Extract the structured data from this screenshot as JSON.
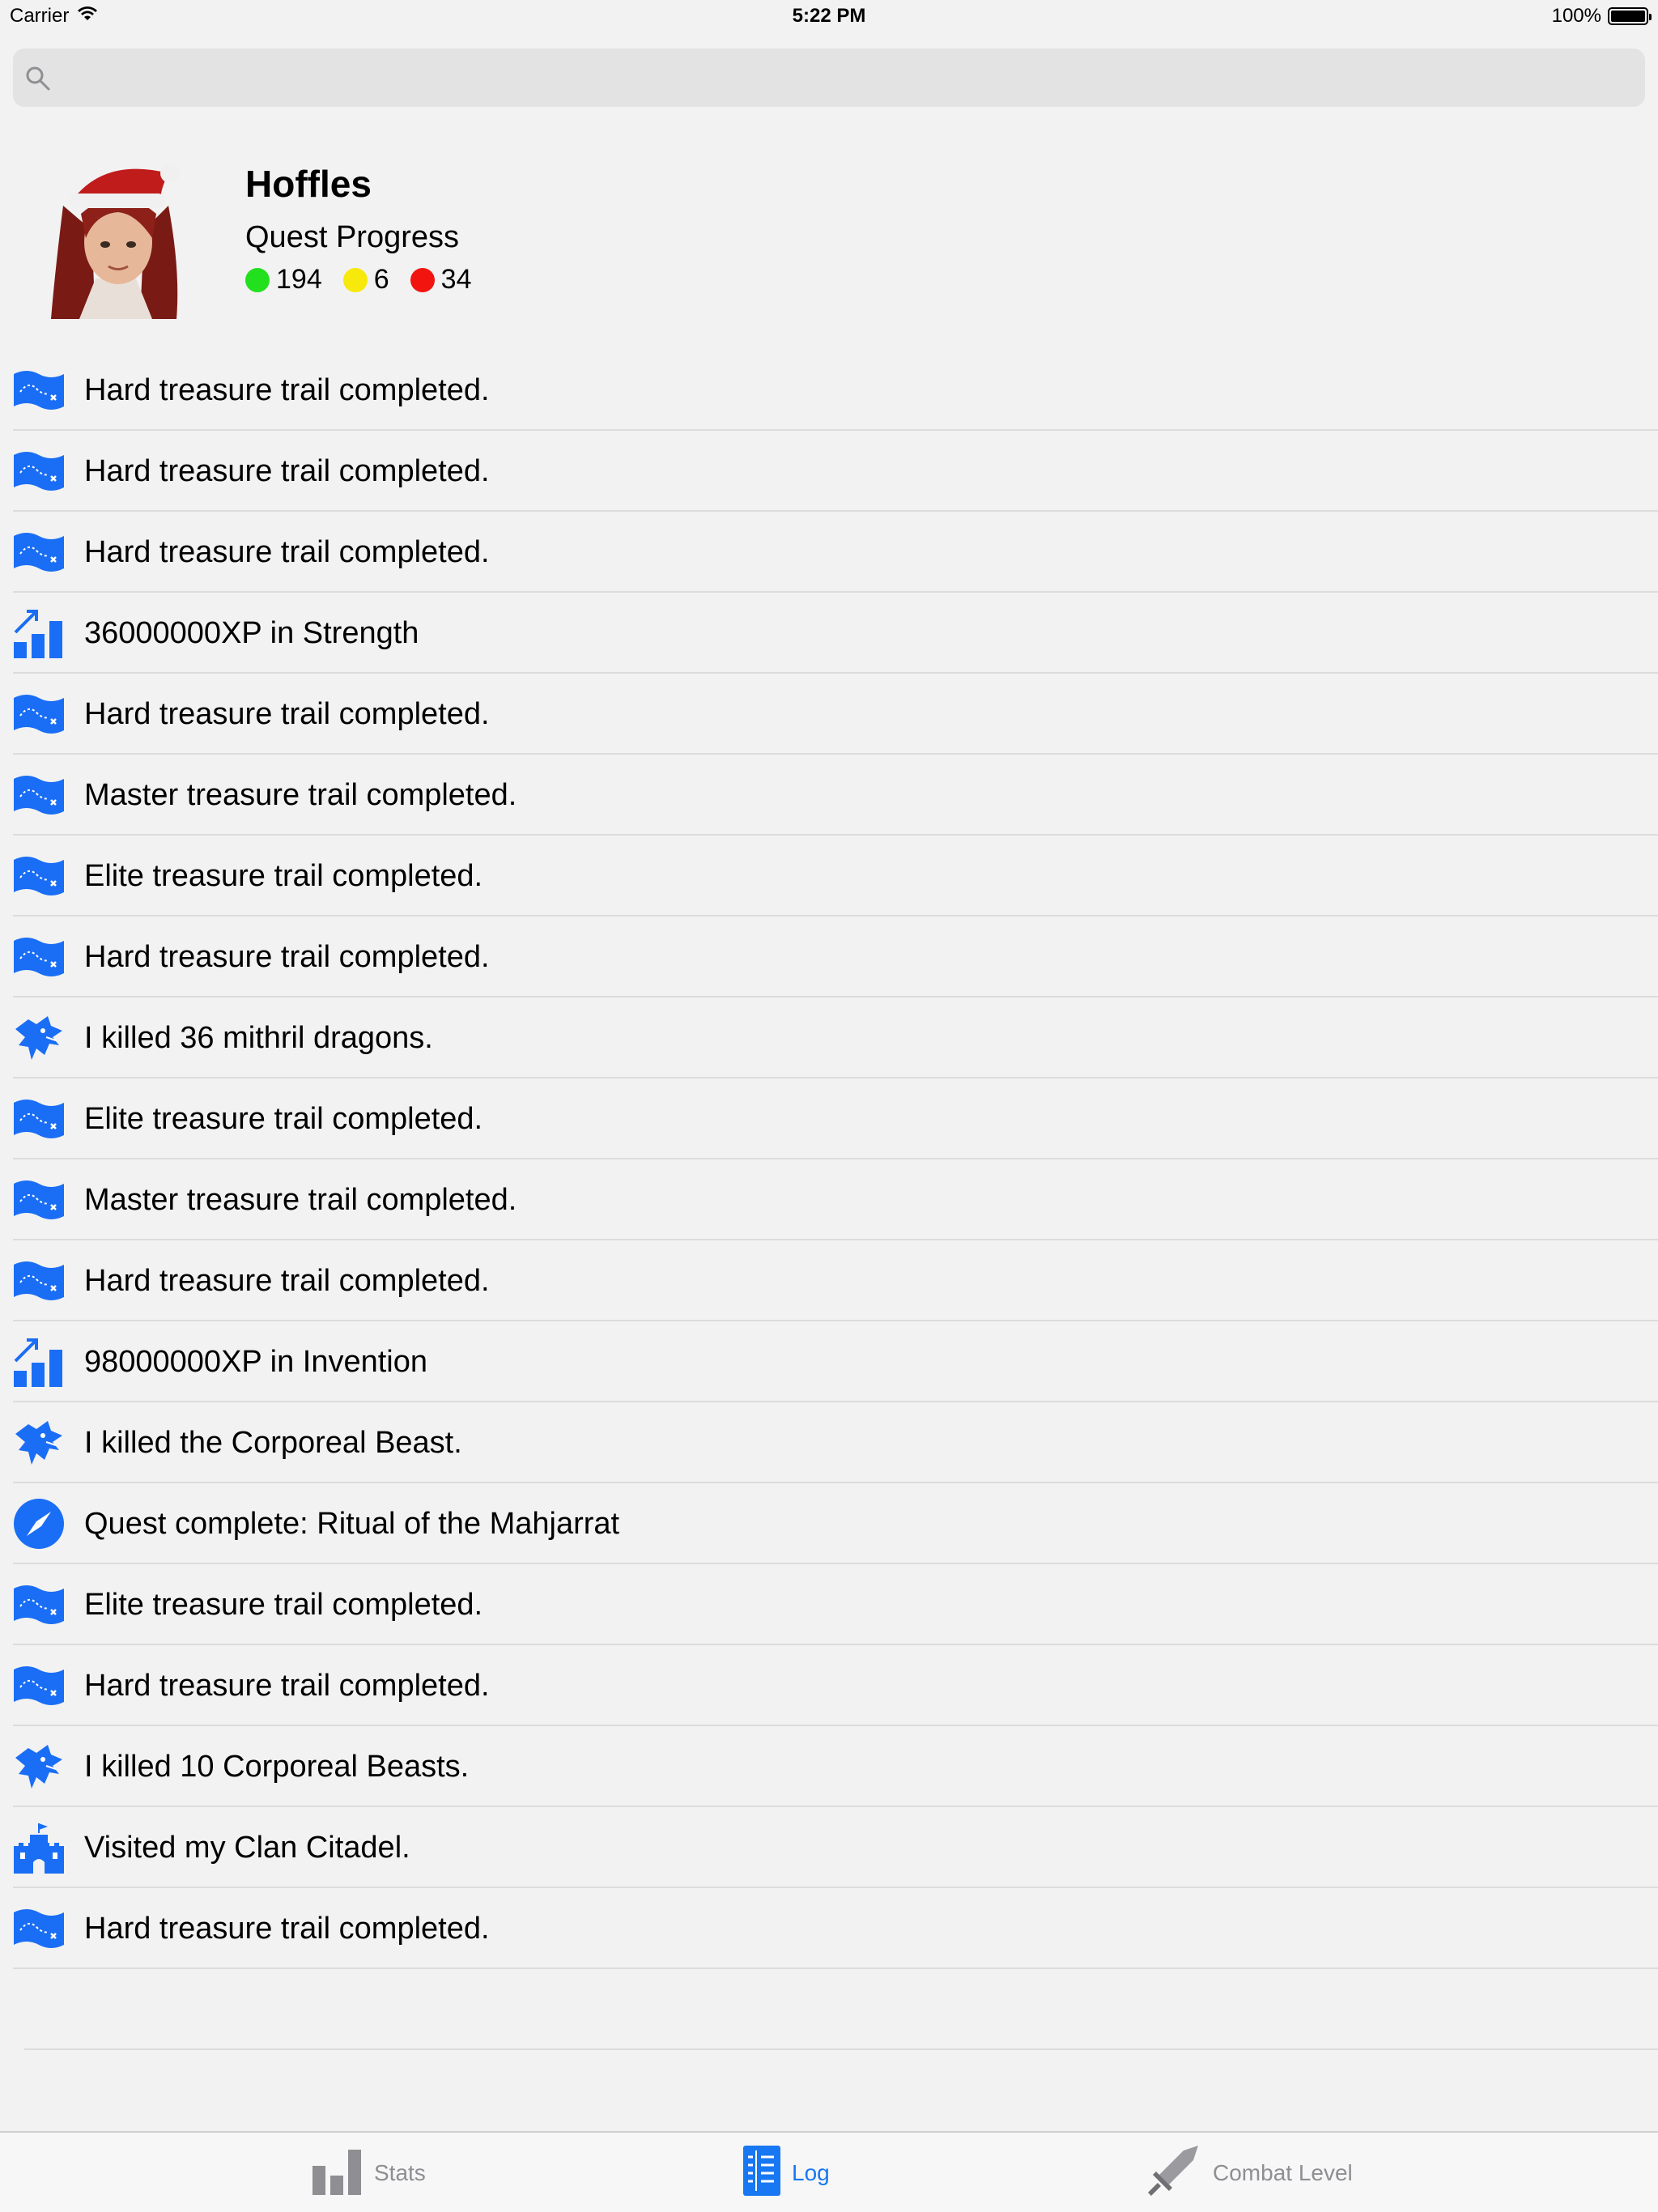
{
  "status_bar": {
    "carrier": "Carrier",
    "time": "5:22 PM",
    "battery": "100%"
  },
  "search": {
    "placeholder": "",
    "icon": "search-icon"
  },
  "profile": {
    "name": "Hoffles",
    "quest_label": "Quest Progress",
    "quest_completed": "194",
    "quest_started": "6",
    "quest_not_started": "34",
    "colors": {
      "completed": "#22e01e",
      "started": "#f6e90b",
      "not_started": "#f2140f"
    }
  },
  "log": [
    {
      "icon": "treasure-map-icon",
      "text": "Hard treasure trail completed."
    },
    {
      "icon": "treasure-map-icon",
      "text": "Hard treasure trail completed."
    },
    {
      "icon": "treasure-map-icon",
      "text": "Hard treasure trail completed."
    },
    {
      "icon": "xp-chart-icon",
      "text": "36000000XP in Strength"
    },
    {
      "icon": "treasure-map-icon",
      "text": "Hard treasure trail completed."
    },
    {
      "icon": "treasure-map-icon",
      "text": "Master treasure trail completed."
    },
    {
      "icon": "treasure-map-icon",
      "text": "Elite treasure trail completed."
    },
    {
      "icon": "treasure-map-icon",
      "text": "Hard treasure trail completed."
    },
    {
      "icon": "dragon-icon",
      "text": "I killed 36 mithril dragons."
    },
    {
      "icon": "treasure-map-icon",
      "text": "Elite treasure trail completed."
    },
    {
      "icon": "treasure-map-icon",
      "text": "Master treasure trail completed."
    },
    {
      "icon": "treasure-map-icon",
      "text": "Hard treasure trail completed."
    },
    {
      "icon": "xp-chart-icon",
      "text": "98000000XP in Invention"
    },
    {
      "icon": "dragon-icon",
      "text": "I killed  the Corporeal Beast."
    },
    {
      "icon": "compass-icon",
      "text": "Quest complete: Ritual of the Mahjarrat"
    },
    {
      "icon": "treasure-map-icon",
      "text": "Elite treasure trail completed."
    },
    {
      "icon": "treasure-map-icon",
      "text": "Hard treasure trail completed."
    },
    {
      "icon": "dragon-icon",
      "text": "I killed 10 Corporeal Beasts."
    },
    {
      "icon": "castle-icon",
      "text": "Visited my Clan Citadel."
    },
    {
      "icon": "treasure-map-icon",
      "text": "Hard treasure trail completed."
    }
  ],
  "tabs": [
    {
      "label": "Stats",
      "icon": "bar-chart-icon",
      "active": false
    },
    {
      "label": "Log",
      "icon": "list-icon",
      "active": true
    },
    {
      "label": "Combat Level",
      "icon": "sword-icon",
      "active": false
    }
  ],
  "accent_color": "#1a6ef5"
}
